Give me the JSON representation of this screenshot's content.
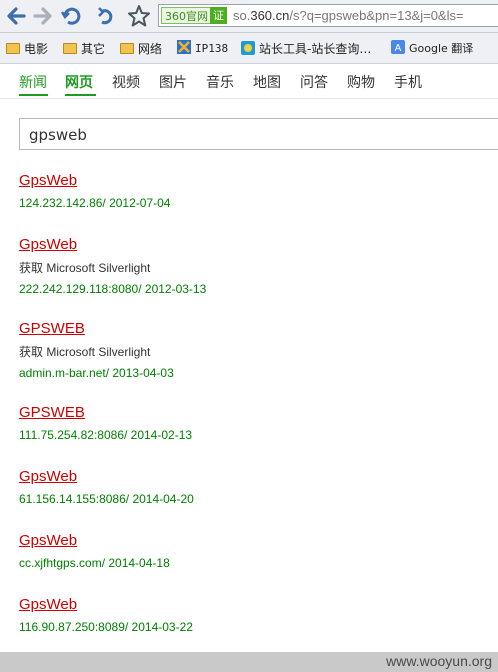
{
  "browser": {
    "address_badge": "360官网",
    "address_verified": "证",
    "url_prefix": "so.",
    "url_domain": "360.cn",
    "url_rest": "/s?q=gpsweb&pn=13&j=0&ls="
  },
  "bookmarks": [
    {
      "label": "电影",
      "icon": "folder-icon"
    },
    {
      "label": "其它",
      "icon": "folder-icon"
    },
    {
      "label": "网络",
      "icon": "folder-icon"
    },
    {
      "label": "IP138",
      "icon": "ip138-favicon"
    },
    {
      "label": "站长工具-站长查询…",
      "icon": "chinaz-favicon"
    },
    {
      "label": "Google 翻译",
      "icon": "google-translate-favicon"
    }
  ],
  "nav": {
    "tabs": [
      "新闻",
      "网页",
      "视频",
      "图片",
      "音乐",
      "地图",
      "问答",
      "购物",
      "手机"
    ],
    "accent_color": "#1e9b22"
  },
  "search": {
    "query": "gpsweb"
  },
  "results": [
    {
      "title": "GpsWeb",
      "desc": "",
      "url": "124.232.142.86/ 2012-07-04"
    },
    {
      "title": "GpsWeb",
      "desc": "获取 Microsoft Silverlight",
      "url": "222.242.129.118:8080/ 2012-03-13"
    },
    {
      "title": "GPSWEB",
      "desc": "获取 Microsoft Silverlight",
      "url": "admin.m-bar.net/ 2013-04-03"
    },
    {
      "title": "GPSWEB",
      "desc": "",
      "url": "111.75.254.82:8086/ 2014-02-13"
    },
    {
      "title": "GpsWeb",
      "desc": "",
      "url": "61.156.14.155:8086/ 2014-04-20"
    },
    {
      "title": "GpsWeb",
      "desc": "",
      "url": "cc.xjfhtgps.com/ 2014-04-18"
    },
    {
      "title": "GpsWeb",
      "desc": "",
      "url": "116.90.87.250:8089/ 2014-03-22"
    }
  ],
  "watermark": "www.wooyun.org"
}
